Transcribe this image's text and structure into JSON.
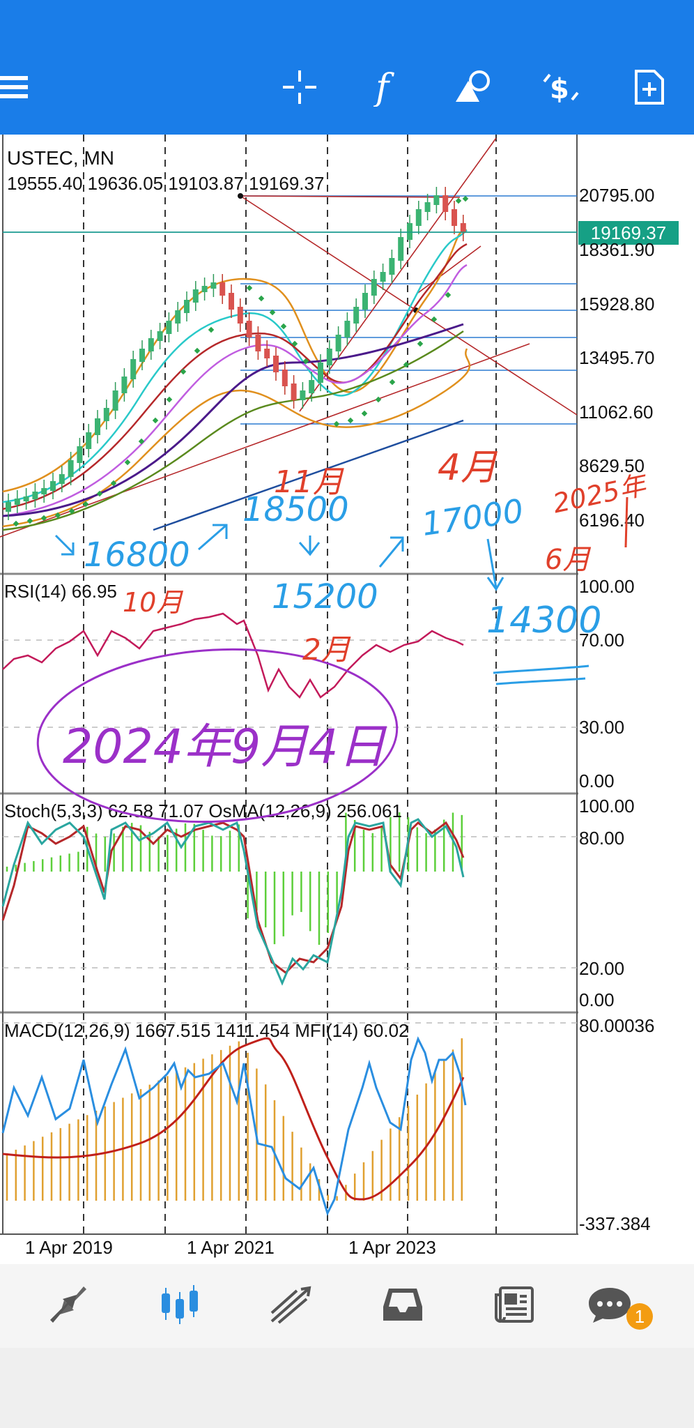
{
  "toolbar": {
    "icons": [
      "menu-icon",
      "crosshair-icon",
      "function-icon",
      "objects-icon",
      "trade-icon",
      "new-order-icon"
    ]
  },
  "main_chart": {
    "symbol": "USTEC, MN",
    "ohlc": "19555.40 19636.05 19103.87 19169.37",
    "current_price": "19169.37",
    "price_axis": [
      "20795.00",
      "18361.90",
      "15928.80",
      "13495.70",
      "11062.60",
      "8629.50",
      "6196.40"
    ]
  },
  "rsi": {
    "label": "RSI(14) 66.95",
    "axis": [
      "100.00",
      "70.00",
      "30.00",
      "0.00"
    ]
  },
  "stoch": {
    "label": "Stoch(5,3,3) 62.58 71.07 OsMA(12,26,9) 256.061",
    "axis": [
      "100.00",
      "80.00",
      "20.00",
      "0.00"
    ]
  },
  "macd": {
    "label": "MACD(12,26,9) 1667.515 1411.454 MFI(14) 60.02",
    "axis": [
      "80.00036",
      "-337.384"
    ]
  },
  "time_axis": [
    "1 Apr 2019",
    "1 Apr 2021",
    "1 Apr 2023"
  ],
  "annotations": {
    "month_11": "11月",
    "month_4": "4月",
    "year_2025": "2025年",
    "month_6": "6月",
    "p16800": "16800",
    "p18500": "18500",
    "p17000": "17000",
    "p15200": "15200",
    "p14300": "14300",
    "month_10": "10月",
    "month_2": "2月",
    "date_note": "2024年9月4日"
  },
  "bottom_nav": {
    "items": [
      "quotes-icon",
      "chart-icon",
      "trade-icon",
      "history-icon",
      "news-icon",
      "messages-icon"
    ],
    "messages_badge": "1"
  },
  "colors": {
    "toolbar": "#1a7de8",
    "price_tag": "#16a085",
    "handwriting_blue": "#2a9ee6",
    "handwriting_red": "#e0402b",
    "handwriting_purple": "#9b30c8"
  }
}
